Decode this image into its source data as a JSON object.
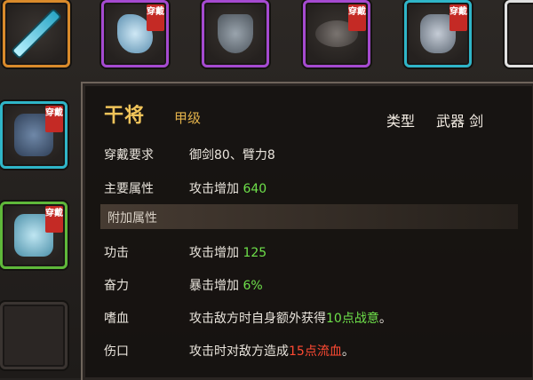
{
  "slots": {
    "badge_text": "穿戴"
  },
  "tooltip": {
    "name": "干将",
    "grade": "甲级",
    "type_label": "类型",
    "type_value": "武器 剑",
    "rows": [
      {
        "label": "穿戴要求",
        "value": "御剑80、臂力8"
      },
      {
        "label": "主要属性",
        "value_prefix": "攻击增加",
        "value_num": "640"
      },
      {
        "label": "功击",
        "value_prefix": "攻击增加",
        "value_num": "125"
      },
      {
        "label": "奋力",
        "value_prefix": "暴击增加",
        "value_num": "6%"
      },
      {
        "label": "嗜血",
        "value_prefix": "攻击敌方时自身额外获得",
        "value_highlight": "10点战意",
        "value_suffix": "。"
      },
      {
        "label": "伤口",
        "value_prefix": "攻击时对敌方造成",
        "value_highlight": "15点流血",
        "value_suffix": "。"
      }
    ],
    "section_header": "附加属性"
  },
  "colors": {
    "title": "#f0c45a",
    "highlight_green": "#6ee04a",
    "highlight_red": "#ff4a33",
    "badge": "#c42a25"
  }
}
